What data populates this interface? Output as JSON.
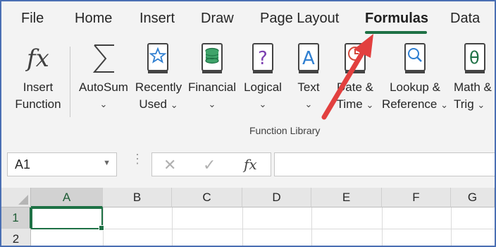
{
  "tabs": [
    "File",
    "Home",
    "Insert",
    "Draw",
    "Page Layout",
    "Formulas",
    "Data"
  ],
  "active_tab": "Formulas",
  "commands": {
    "insert_function": {
      "line1": "Insert",
      "line2": "Function",
      "icon": "fx-icon"
    },
    "autosum": {
      "line1": "AutoSum",
      "icon": "sigma-icon"
    },
    "recently_used": {
      "line1": "Recently",
      "line2": "Used",
      "icon": "star-book-icon"
    },
    "financial": {
      "line1": "Financial",
      "icon": "coins-book-icon"
    },
    "logical": {
      "line1": "Logical",
      "icon": "question-book-icon"
    },
    "text": {
      "line1": "Text",
      "icon": "letter-a-book-icon"
    },
    "date_time": {
      "line1": "Date &",
      "line2": "Time",
      "icon": "clock-book-icon"
    },
    "lookup_reference": {
      "line1": "Lookup &",
      "line2": "Reference",
      "icon": "magnifier-book-icon"
    },
    "math_trig": {
      "line1": "Math &",
      "line2": "Trig",
      "icon": "theta-book-icon"
    }
  },
  "group_label": "Function Library",
  "name_box": {
    "value": "A1"
  },
  "formula_bar": {
    "fx": "fx",
    "cancel": "✕",
    "enter": "✓",
    "value": ""
  },
  "columns": [
    "A",
    "B",
    "C",
    "D",
    "E",
    "F",
    "G"
  ],
  "rows": [
    "1",
    "2"
  ],
  "active_cell": "A1",
  "colors": {
    "accent": "#1e7145",
    "arrow": "#e2403f",
    "frame": "#4a6fb3"
  }
}
